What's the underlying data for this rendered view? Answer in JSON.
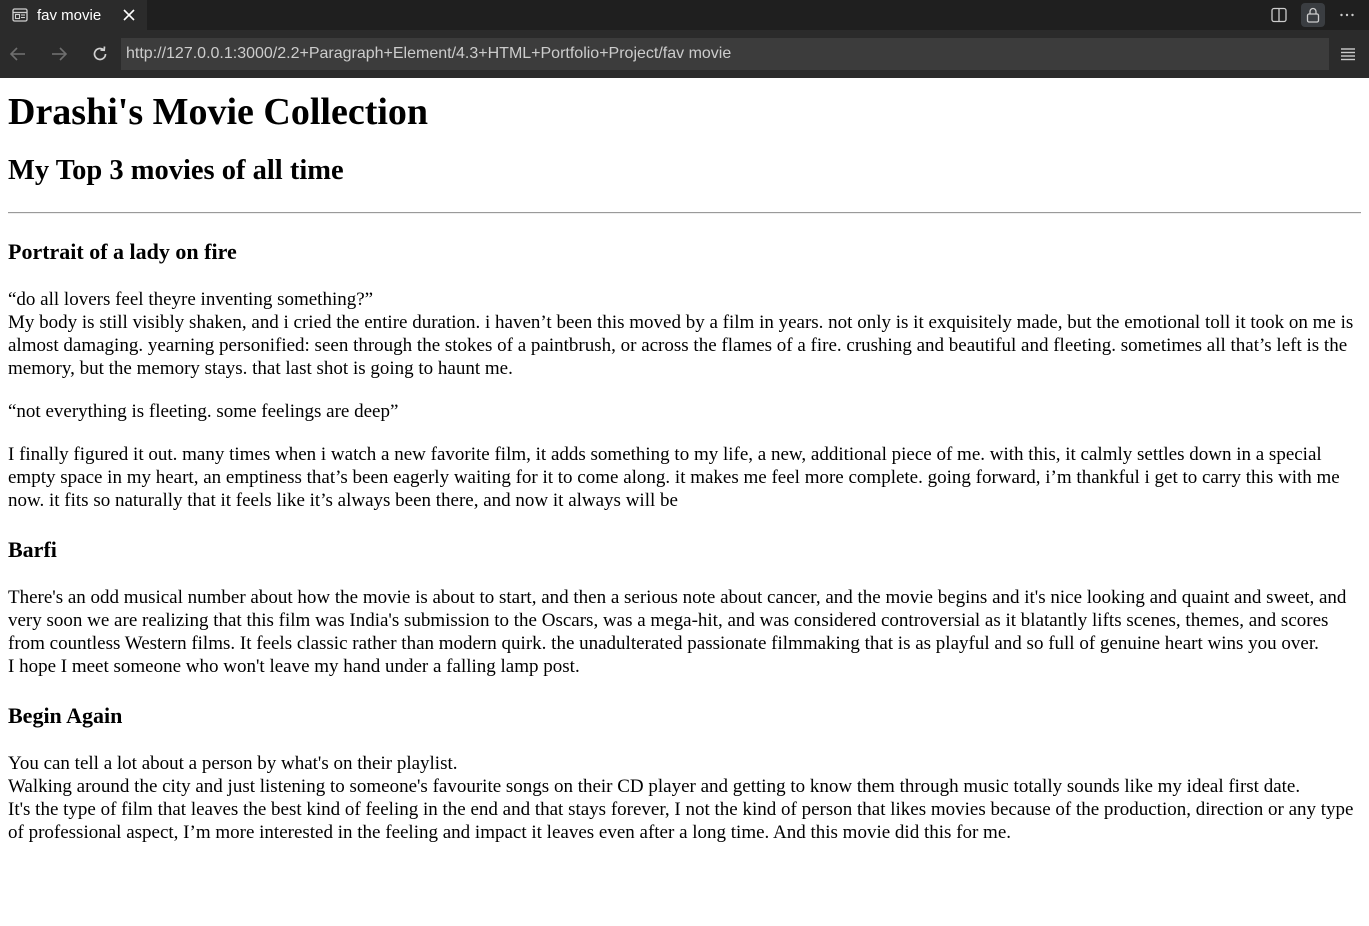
{
  "browser": {
    "tab_title": "fav movie",
    "url": "http://127.0.0.1:3000/2.2+Paragraph+Element/4.3+HTML+Portfolio+Project/fav movie"
  },
  "page": {
    "title": "Drashi's Movie Collection",
    "subtitle": "My Top 3 movies of all time",
    "movies": [
      {
        "title": "Portrait of a lady on fire",
        "quote1": "“do all lovers feel theyre inventing something?”",
        "review1": "My body is still visibly shaken, and i cried the entire duration. i haven’t been this moved by a film in years. not only is it exquisitely made, but the emotional toll it took on me is almost damaging. yearning personified: seen through the stokes of a paintbrush, or across the flames of a fire. crushing and beautiful and fleeting. sometimes all that’s left is the memory, but the memory stays. that last shot is going to haunt me.",
        "quote2": "“not everything is fleeting. some feelings are deep”",
        "review2": "I finally figured it out. many times when i watch a new favorite film, it adds something to my life, a new, additional piece of me. with this, it calmly settles down in a special empty space in my heart, an emptiness that’s been eagerly waiting for it to come along. it makes me feel more complete. going forward, i’m thankful i get to carry this with me now. it fits so naturally that it feels like it’s always been there, and now it always will be"
      },
      {
        "title": "Barfi",
        "review1": "There's an odd musical number about how the movie is about to start, and then a serious note about cancer, and the movie begins and it's nice looking and quaint and sweet, and very soon we are realizing that this film was India's submission to the Oscars, was a mega-hit, and was considered controversial as it blatantly lifts scenes, themes, and scores from countless Western films. It feels classic rather than modern quirk. the unadulterated passionate filmmaking that is as playful and so full of genuine heart wins you over.",
        "review2": "I hope I meet someone who won't leave my hand under a falling lamp post."
      },
      {
        "title": "Begin Again",
        "line1": "You can tell a lot about a person by what's on their playlist.",
        "line2": "Walking around the city and just listening to someone's favourite songs on their CD player and getting to know them through music totally sounds like my ideal first date.",
        "line3": "It's the type of film that leaves the best kind of feeling in the end and that stays forever, I not the kind of person that likes movies because of the production, direction or any type of professional aspect, I’m more interested in the feeling and impact it leaves even after a long time. And this movie did this for me."
      }
    ]
  }
}
